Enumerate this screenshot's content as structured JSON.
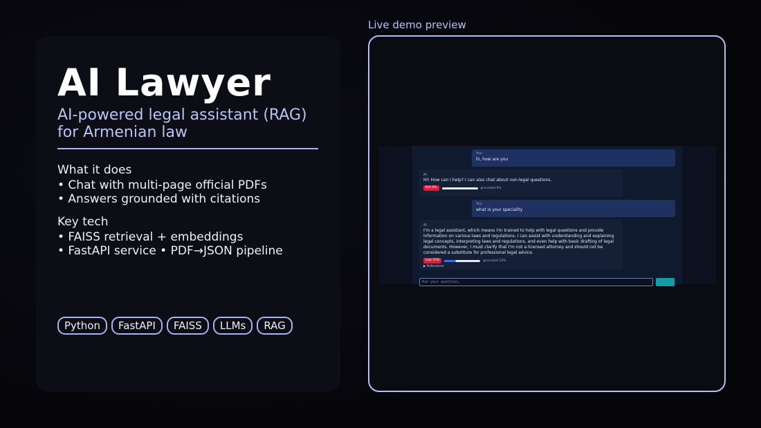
{
  "card": {
    "title": "AI Lawyer",
    "subtitle": "AI-powered legal assistant (RAG) for Armenian law",
    "what_it_does": {
      "heading": "What it does",
      "bullets": [
        "• Chat with multi-page official PDFs",
        "• Answers grounded with citations"
      ]
    },
    "key_tech": {
      "heading": "Key tech",
      "bullets": [
        "• FAISS retrieval + embeddings",
        "• FastAPI service • PDF→JSON pipeline"
      ]
    },
    "tags": [
      "Python",
      "FastAPI",
      "FAISS",
      "LLMs",
      "RAG"
    ]
  },
  "preview": {
    "label": "Live demo preview",
    "messages": [
      {
        "role": "user",
        "who": "You",
        "text": "hi, how are you"
      },
      {
        "role": "ai",
        "who": "AI",
        "text": "Hi! How can I help? I can also chat about non-legal questions.",
        "badge": "N/A 0%",
        "grounded": "grounded 0%",
        "grounded_fraction": 0.0
      },
      {
        "role": "user",
        "who": "You",
        "text": "what is your speciality"
      },
      {
        "role": "ai",
        "who": "AI",
        "text": "I'm a legal assistant, which means I'm trained to help with legal questions and provide information on various laws and regulations. I can assist with understanding and explaining legal concepts, interpreting laws and regulations, and even help with basic drafting of legal documents. However, I must clarify that I'm not a licensed attorney and should not be considered a substitute for professional legal advice.",
        "badge": "Low 35%",
        "grounded": "grounded 33%",
        "grounded_fraction": 0.33,
        "references": "▶ References"
      }
    ],
    "input_placeholder": "Ask your question…"
  },
  "colors": {
    "accent": "#aab4ee",
    "badge_red": "#d81f3c",
    "send_teal": "#159aa6"
  }
}
